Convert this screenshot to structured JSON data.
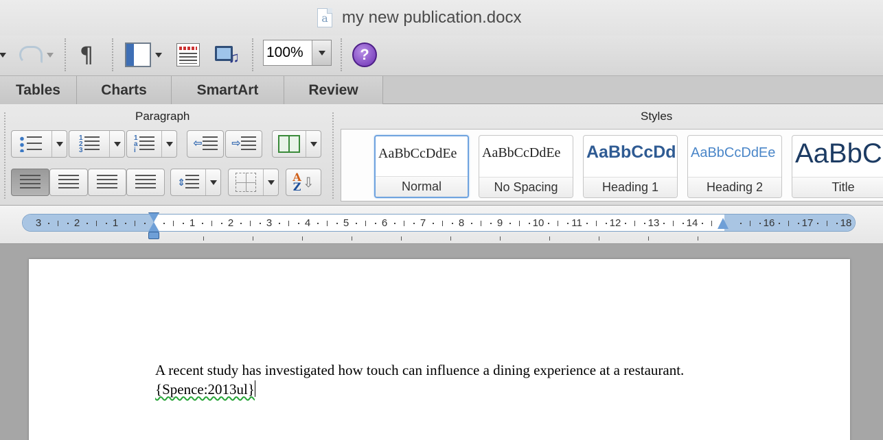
{
  "window": {
    "title": "my new publication.docx"
  },
  "toolbar": {
    "zoom": "100%",
    "help_label": "?"
  },
  "tabs": [
    "Tables",
    "Charts",
    "SmartArt",
    "Review"
  ],
  "ribbon": {
    "paragraph_label": "Paragraph",
    "styles_label": "Styles",
    "styles": [
      {
        "name": "Normal",
        "sample": "AaBbCcDdEe"
      },
      {
        "name": "No Spacing",
        "sample": "AaBbCcDdEe"
      },
      {
        "name": "Heading 1",
        "sample": "AaBbCcDd"
      },
      {
        "name": "Heading 2",
        "sample": "AaBbCcDdEe"
      },
      {
        "name": "Title",
        "sample": "AaBbC"
      }
    ],
    "accent_color": "#3b6fb3"
  },
  "ruler": {
    "left_numbers": [
      "3",
      "2",
      "1"
    ],
    "right_numbers": [
      "1",
      "2",
      "3",
      "4",
      "5",
      "6",
      "7",
      "8",
      "9",
      "10",
      "11",
      "12",
      "13",
      "14",
      "",
      "16",
      "17",
      "18"
    ]
  },
  "document": {
    "text": "A recent study has investigated how touch can influence a dining experience at a restaurant.  ",
    "citation": "{Spence:2013ul}"
  }
}
